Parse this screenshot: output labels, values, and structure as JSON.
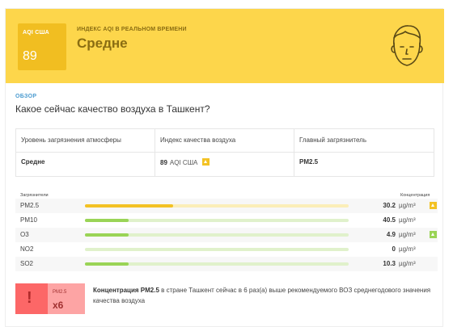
{
  "colors": {
    "header_bg": "#fdd64b",
    "aqi_box": "#f1be21",
    "bar_yellow": "#f3c224",
    "bar_green": "#9ad456",
    "track_yellow": "#fbeeb8",
    "track_green": "#e0f1cb",
    "alert_red": "#fc6767",
    "alert_light": "#fda4a4",
    "link_blue": "#4b9bd0"
  },
  "header": {
    "aqi_label": "AQI США",
    "aqi_value": "89",
    "realtime_label": "ИНДЕКС AQI В РЕАЛЬНОМ ВРЕМЕНИ",
    "status": "Средне",
    "face_icon": "face-moderate-icon"
  },
  "overview": {
    "section_label": "ОБЗОР",
    "question": "Какое сейчас качество воздуха в Ташкент?"
  },
  "summary_table": {
    "headers": [
      "Уровень загрязнения атмосферы",
      "Индекс качества воздуха",
      "Главный загрязнитель"
    ],
    "level": "Средне",
    "aqi_number": "89",
    "aqi_unit": "AQI США",
    "main_pollutant": "PM2.5"
  },
  "pollutants": {
    "header_left": "Загрязнители",
    "header_right": "Концентрация",
    "unit": "µg/m³",
    "items": [
      {
        "name": "PM2.5",
        "value": "30.2",
        "level": 0.335,
        "color": "yellow",
        "indicator": "yellow"
      },
      {
        "name": "PM10",
        "value": "40.5",
        "level": 0.165,
        "color": "green",
        "indicator": ""
      },
      {
        "name": "O3",
        "value": "4.9",
        "level": 0.165,
        "color": "green",
        "indicator": "green"
      },
      {
        "name": "NO2",
        "value": "0",
        "level": 0.0,
        "color": "green",
        "indicator": ""
      },
      {
        "name": "SO2",
        "value": "10.3",
        "level": 0.165,
        "color": "green",
        "indicator": ""
      }
    ]
  },
  "alert": {
    "pollutant": "PM2.5",
    "multiplier": "x6",
    "text_bold": "Концентрация PM2.5",
    "text_rest": " в стране Ташкент сейчас в 6 раз(а) выше рекомендуемого ВОЗ среднегодового значения качества воздуха"
  }
}
